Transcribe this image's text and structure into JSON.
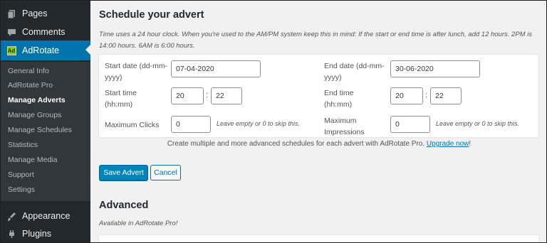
{
  "sidebar": {
    "items": [
      {
        "label": "Pages",
        "icon": "pages-icon"
      },
      {
        "label": "Comments",
        "icon": "comments-icon"
      },
      {
        "label": "AdRotate",
        "icon": "adrotate-icon"
      }
    ],
    "submenu": [
      {
        "label": "General Info"
      },
      {
        "label": "AdRotate Pro"
      },
      {
        "label": "Manage Adverts"
      },
      {
        "label": "Manage Groups"
      },
      {
        "label": "Manage Schedules"
      },
      {
        "label": "Statistics"
      },
      {
        "label": "Manage Media"
      },
      {
        "label": "Support"
      },
      {
        "label": "Settings"
      }
    ],
    "bottom_items": [
      {
        "label": "Appearance",
        "icon": "appearance-icon"
      },
      {
        "label": "Plugins",
        "icon": "plugins-icon"
      }
    ],
    "adrotate_logo_text": "Ad"
  },
  "schedule": {
    "title": "Schedule your advert",
    "note": "Time uses a 24 hour clock. When you're used to the AM/PM system keep this in mind: If the start or end time is after lunch, add 12 hours. 2PM is 14:00 hours. 6AM is 6:00 hours.",
    "start_date_label": "Start date (dd-mm-yyyy)",
    "start_date_value": "07-04-2020",
    "end_date_label": "End date (dd-mm-yyyy)",
    "end_date_value": "30-06-2020",
    "start_time_label": "Start time (hh:mm)",
    "start_hour": "20",
    "start_minute": "22",
    "end_time_label": "End time (hh:mm)",
    "end_hour": "20",
    "end_minute": "22",
    "time_separator": ":",
    "max_clicks_label": "Maximum Clicks",
    "max_clicks_value": "0",
    "max_clicks_hint": "Leave empty or 0 to skip this.",
    "max_impressions_label": "Maximum Impressions",
    "max_impressions_value": "0",
    "max_impressions_hint": "Leave empty or 0 to skip this.",
    "promo_text": "Create multiple and more advanced schedules for each advert with AdRotate Pro.",
    "promo_link": "Upgrade now",
    "promo_suffix": "!"
  },
  "actions": {
    "save_label": "Save Advert",
    "cancel_label": "Cancel"
  },
  "advanced": {
    "title": "Advanced",
    "note": "Available in AdRotate Pro!"
  },
  "colors": {
    "sidebar_bg": "#23282d",
    "submenu_bg": "#32373c",
    "accent": "#0073aa",
    "primary_button": "#0085ba"
  }
}
